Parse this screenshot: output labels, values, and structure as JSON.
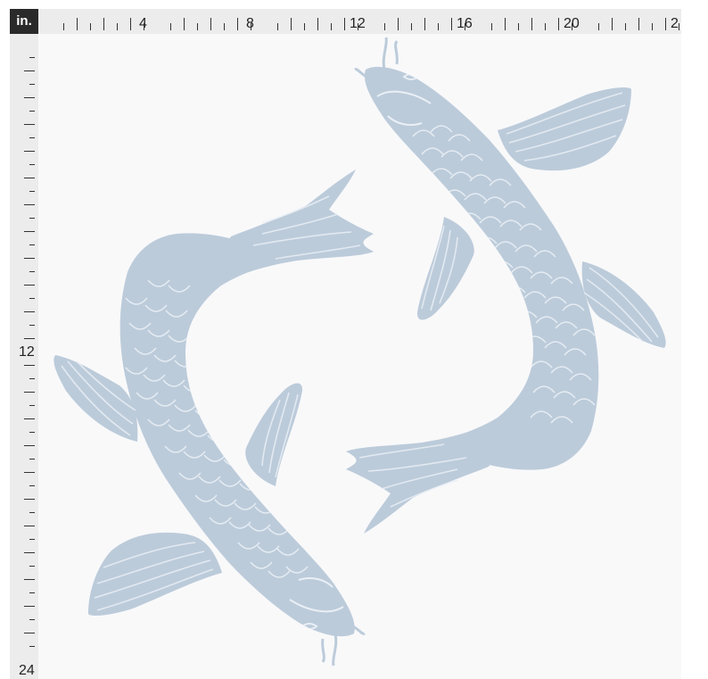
{
  "ruler": {
    "unit": "in.",
    "top_labels": [
      "4",
      "8",
      "12",
      "16",
      "20",
      "2"
    ],
    "left_labels": [
      "12",
      "24"
    ]
  },
  "design": {
    "motif": "two koi fish",
    "fish_color": "#bccbda",
    "detail_color": "#e9eff5",
    "background_color": "#f9f9fa"
  }
}
